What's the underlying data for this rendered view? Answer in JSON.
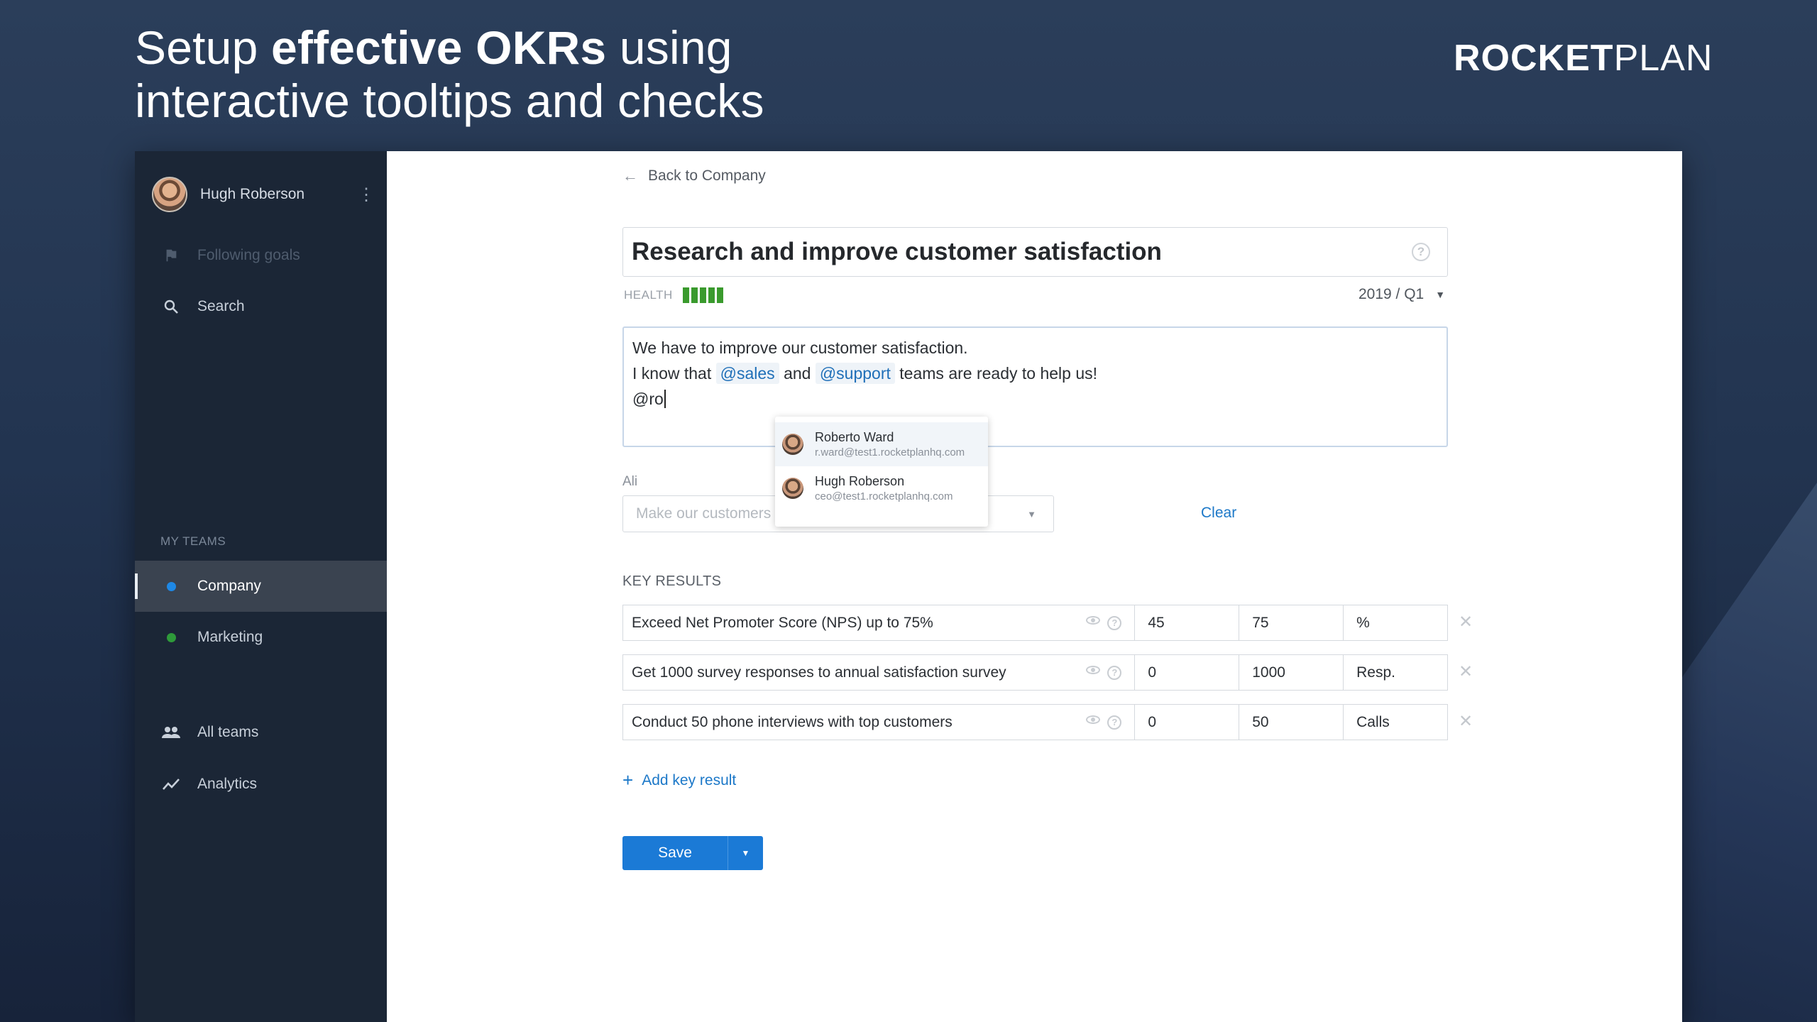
{
  "headline": {
    "line1_pre": "Setup ",
    "line1_bold": "effective OKRs",
    "line1_post": " using",
    "line2": "interactive tooltips and checks"
  },
  "brand": {
    "bold": "ROCKET",
    "light": "PLAN"
  },
  "sidebar": {
    "user_name": "Hugh Roberson",
    "items": [
      {
        "label": "Following goals",
        "icon": "flag-icon"
      },
      {
        "label": "Search",
        "icon": "search-icon"
      }
    ],
    "section_label": "MY TEAMS",
    "teams": [
      {
        "label": "Company",
        "dot_color": "#1e88e5"
      },
      {
        "label": "Marketing",
        "dot_color": "#2e9a3a"
      }
    ],
    "bottom_items": [
      {
        "label": "All teams",
        "icon": "people-icon"
      },
      {
        "label": "Analytics",
        "icon": "chart-icon"
      }
    ]
  },
  "main": {
    "back_label": "Back to Company",
    "title": "Research and improve customer satisfaction",
    "health_label": "HEALTH",
    "health_level": 5,
    "period": "2019 / Q1",
    "description": {
      "line1": "We have to improve our customer satisfaction.",
      "line2_a": "I know that",
      "mention1": "@sales",
      "line2_b": "and",
      "mention2": "@support",
      "line2_c": "teams are ready to help us!",
      "line3": "@ro"
    },
    "align_label": "Ali",
    "align_placeholder": "Make our customers happy",
    "clear_label": "Clear",
    "mention_suggestions": [
      {
        "name": "Roberto Ward",
        "email": "r.ward@test1.rocketplanhq.com"
      },
      {
        "name": "Hugh Roberson",
        "email": "ceo@test1.rocketplanhq.com"
      }
    ],
    "key_results_heading": "KEY RESULTS",
    "key_results": [
      {
        "name": "Exceed Net Promoter Score (NPS) up to 75%",
        "start": "45",
        "target": "75",
        "unit": "%"
      },
      {
        "name": "Get 1000 survey responses to annual satisfaction survey",
        "start": "0",
        "target": "1000",
        "unit": "Resp."
      },
      {
        "name": "Conduct 50 phone interviews with top customers",
        "start": "0",
        "target": "50",
        "unit": "Calls"
      }
    ],
    "add_kr_label": "Add key result",
    "save_label": "Save",
    "remove_glyph": "✕",
    "help_glyph": "?"
  }
}
